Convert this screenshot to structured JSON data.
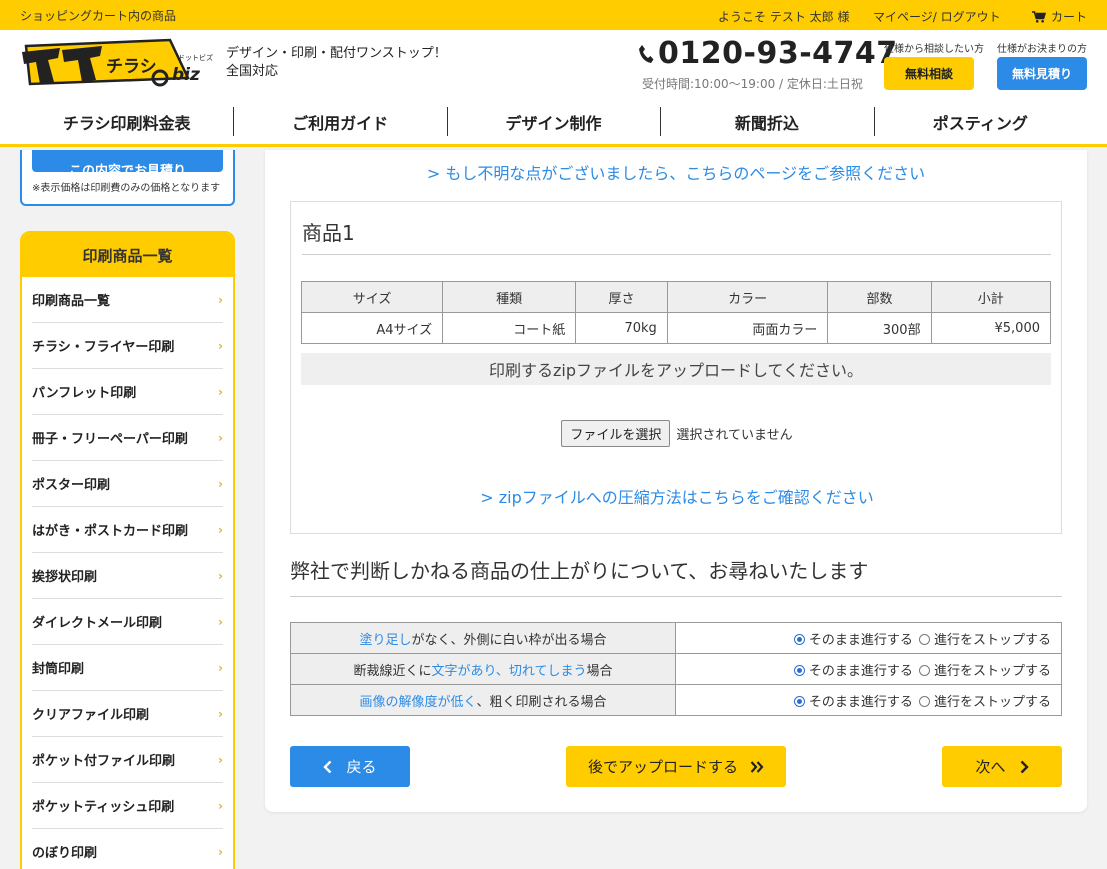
{
  "topbar": {
    "left_text": "ショッピングカート内の商品",
    "user_text": "ようこそ テスト 太郎 様",
    "mypage_link": "マイページ/ ログアウト",
    "cart_label": "カート"
  },
  "header": {
    "logo_text": "イイチラシ",
    "logo_sub": ".biz",
    "tagline_line1": "デザイン・印刷・配付ワンストップ！",
    "tagline_line2": "全国対応",
    "phone": "0120-93-4747",
    "hours": "受付時間:10:00〜19:00 / 定休日:土日祝",
    "consult_caption": "仕様から相談したい方",
    "consult_button": "無料相談",
    "quote_caption": "仕様がお決まりの方",
    "quote_button": "無料見積り"
  },
  "nav": {
    "items": [
      "チラシ印刷料金表",
      "ご利用ガイド",
      "デザイン制作",
      "新聞折込",
      "ポスティング"
    ]
  },
  "sidebar": {
    "estimate_button": "この内容でお見積り",
    "price_note": "※表示価格は印刷費のみの価格となります",
    "heading": "印刷商品一覧",
    "items": [
      "印刷商品一覧",
      "チラシ・フライヤー印刷",
      "パンフレット印刷",
      "冊子・フリーペーパー印刷",
      "ポスター印刷",
      "はがき・ポストカード印刷",
      "挨拶状印刷",
      "ダイレクトメール印刷",
      "封筒印刷",
      "クリアファイル印刷",
      "ポケット付ファイル印刷",
      "ポケットティッシュ印刷",
      "のぼり印刷"
    ]
  },
  "main": {
    "help_link": "> もし不明な点がございましたら、こちらのページをご参照ください",
    "product_title": "商品1",
    "spec_headers": [
      "サイズ",
      "種類",
      "厚さ",
      "カラー",
      "部数",
      "小計"
    ],
    "spec_values": [
      "A4サイズ",
      "コート紙",
      "70kg",
      "両面カラー",
      "300部",
      "¥5,000"
    ],
    "upload_message": "印刷するzipファイルをアップロードしてください。",
    "file_button": "ファイルを選択",
    "file_status": "選択されていません",
    "zip_link": "> zipファイルへの圧縮方法はこちらをご確認ください",
    "question_title": "弊社で判断しかねる商品の仕上がりについて、お尋ねいたします",
    "questions": [
      {
        "pre": "",
        "highlight": "塗り足し",
        "post": "がなく、外側に白い枠が出る場合"
      },
      {
        "pre": "断裁線近くに",
        "highlight": "文字があり、切れてしまう",
        "post": "場合"
      },
      {
        "pre": "",
        "highlight": "画像の解像度が低く",
        "post": "、粗く印刷される場合"
      }
    ],
    "option_continue": "そのまま進行する",
    "option_stop": "進行をストップする",
    "back_button": "戻る",
    "later_button": "後でアップロードする",
    "next_button": "次へ"
  },
  "colors": {
    "accent_yellow": "#ffcc00",
    "accent_blue": "#2b8be6"
  }
}
